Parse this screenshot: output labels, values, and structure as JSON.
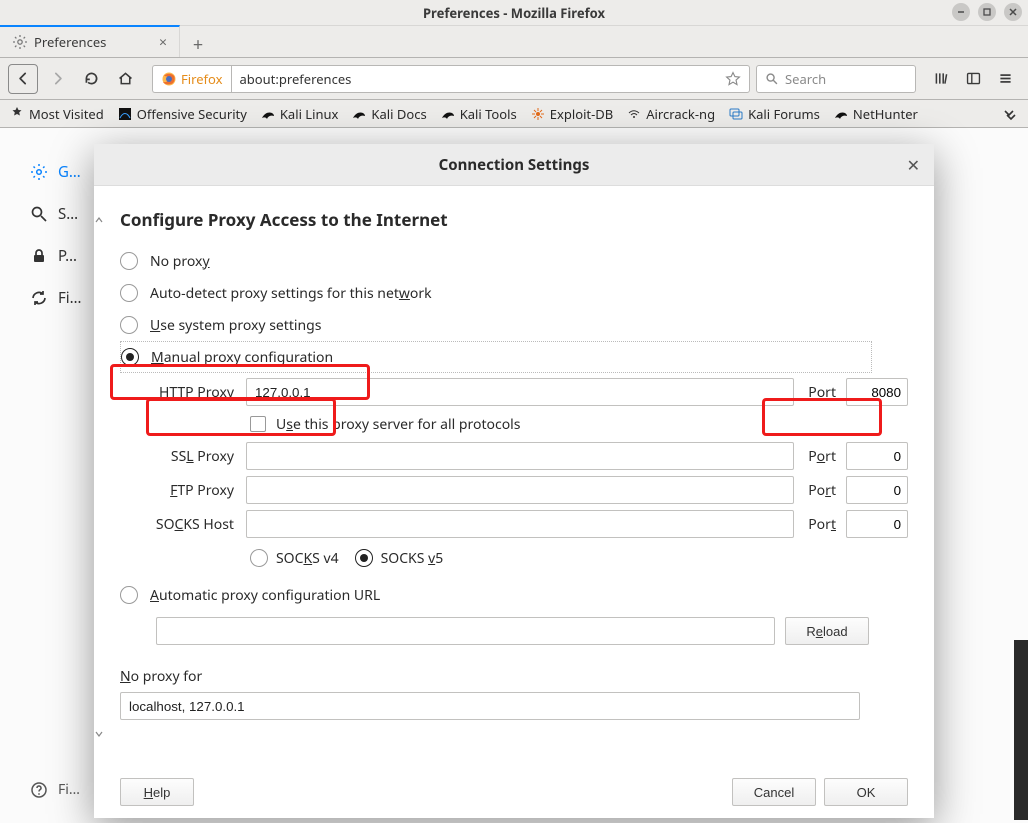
{
  "window": {
    "title": "Preferences - Mozilla Firefox"
  },
  "tabs": {
    "active": {
      "title": "Preferences"
    }
  },
  "url": {
    "brand": "Firefox",
    "address": "about:preferences"
  },
  "search": {
    "placeholder": "Search"
  },
  "bookmarks": {
    "items": [
      "Most Visited",
      "Offensive Security",
      "Kali Linux",
      "Kali Docs",
      "Kali Tools",
      "Exploit-DB",
      "Aircrack-ng",
      "Kali Forums",
      "NetHunter"
    ]
  },
  "sidebar": {
    "items": [
      {
        "label": "General"
      },
      {
        "label": "Search"
      },
      {
        "label": "Privacy & Security"
      },
      {
        "label": "Firefox Account"
      }
    ],
    "footer": "Firefox Support"
  },
  "modal": {
    "title": "Connection Settings",
    "section_title": "Configure Proxy Access to the Internet",
    "radios": {
      "no_proxy": "No prox",
      "no_proxy_u": "y",
      "auto_detect": "Auto-detect proxy settings for this net",
      "auto_detect_u": "w",
      "auto_detect_tail": "ork",
      "use_system_head": "",
      "use_system_u": "U",
      "use_system_tail": "se system proxy settings",
      "manual_head": "",
      "manual_u": "M",
      "manual_tail": "anual proxy configuration",
      "auto_url_head": "",
      "auto_url_u": "A",
      "auto_url_tail": "utomatic proxy configuration URL"
    },
    "http": {
      "label_pre": "HTTP Pro",
      "label_u": "x",
      "label_post": "y",
      "value": "127.0.0.1",
      "port_label_u": "P",
      "port_label_tail": "ort",
      "port": "8080"
    },
    "use_all": {
      "pre": "U",
      "u": "s",
      "post": "e this proxy server for all protocols"
    },
    "ssl": {
      "label_pre": "SS",
      "label_u": "L",
      "label_post": " Proxy",
      "value": "",
      "port_pre": "P",
      "port_u": "o",
      "port_tail": "rt",
      "port": "0"
    },
    "ftp": {
      "label_u": "F",
      "label_tail": "TP Proxy",
      "value": "",
      "port_pre": "Po",
      "port_u": "r",
      "port_tail": "t",
      "port": "0"
    },
    "socks": {
      "label_pre": "SO",
      "label_u": "C",
      "label_post": "KS Host",
      "value": "",
      "port_pre": "Por",
      "port_u": "t",
      "port_tail": "",
      "port": "0"
    },
    "socksver": {
      "v4_pre": "SOC",
      "v4_u": "K",
      "v4_tail": "S v4",
      "v5_pre": "SOCKS ",
      "v5_u": "v",
      "v5_tail": "5"
    },
    "reload": {
      "label_pre": "R",
      "label_u": "e",
      "label_post": "load"
    },
    "noproxy": {
      "label_u": "N",
      "label_tail": "o proxy for",
      "value": "localhost, 127.0.0.1"
    },
    "buttons": {
      "help_u": "H",
      "help_tail": "elp",
      "cancel": "Cancel",
      "ok": "OK"
    }
  }
}
